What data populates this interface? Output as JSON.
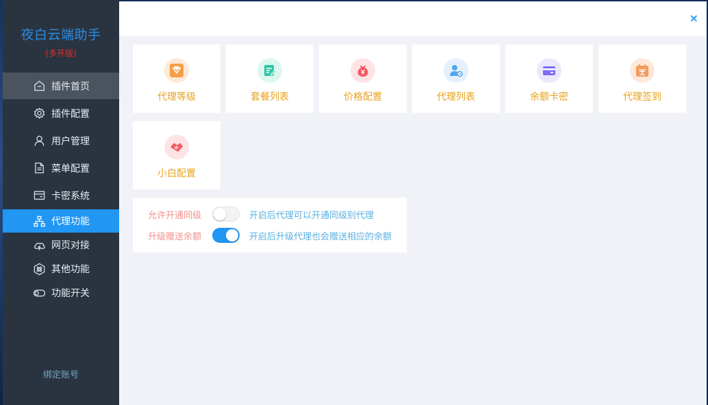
{
  "app": {
    "title": "夜白云端助手",
    "subtitle": "(多开版)"
  },
  "sidebar": {
    "items": [
      {
        "label": "插件首页",
        "icon": "home-icon"
      },
      {
        "label": "插件配置",
        "icon": "gear-icon"
      },
      {
        "label": "用户管理",
        "icon": "user-icon"
      },
      {
        "label": "菜单配置",
        "icon": "document-icon"
      },
      {
        "label": "卡密系统",
        "icon": "card-icon"
      },
      {
        "label": "代理功能",
        "icon": "sitemap-icon",
        "active": true
      },
      {
        "label": "网页对接",
        "icon": "cloud-icon"
      },
      {
        "label": "其他功能",
        "icon": "grid-icon"
      },
      {
        "label": "功能开关",
        "icon": "toggle-icon"
      }
    ],
    "bind_label": "绑定账号"
  },
  "topbar": {
    "close": "×"
  },
  "cards": [
    {
      "label": "代理等级",
      "icon": "diamond-icon",
      "color": "#f4a04a"
    },
    {
      "label": "套餐列表",
      "icon": "edit-list-icon",
      "color": "#2fc6a6"
    },
    {
      "label": "价格配置",
      "icon": "money-bag-icon",
      "color": "#f25a63"
    },
    {
      "label": "代理列表",
      "icon": "user-settings-icon",
      "color": "#53a6ea"
    },
    {
      "label": "余额卡密",
      "icon": "wallet-card-icon",
      "color": "#7b6cf0"
    },
    {
      "label": "代理签到",
      "icon": "calendar-sign-icon",
      "color": "#f59a5a"
    },
    {
      "label": "小白配置",
      "icon": "handshake-icon",
      "color": "#f25a63"
    }
  ],
  "settings": [
    {
      "label": "允许开通同级",
      "enabled": false,
      "desc": "开启后代理可以开通同级别代理"
    },
    {
      "label": "升级赠送余额",
      "enabled": true,
      "desc": "开启后升级代理也会赠送相应的余额"
    }
  ]
}
